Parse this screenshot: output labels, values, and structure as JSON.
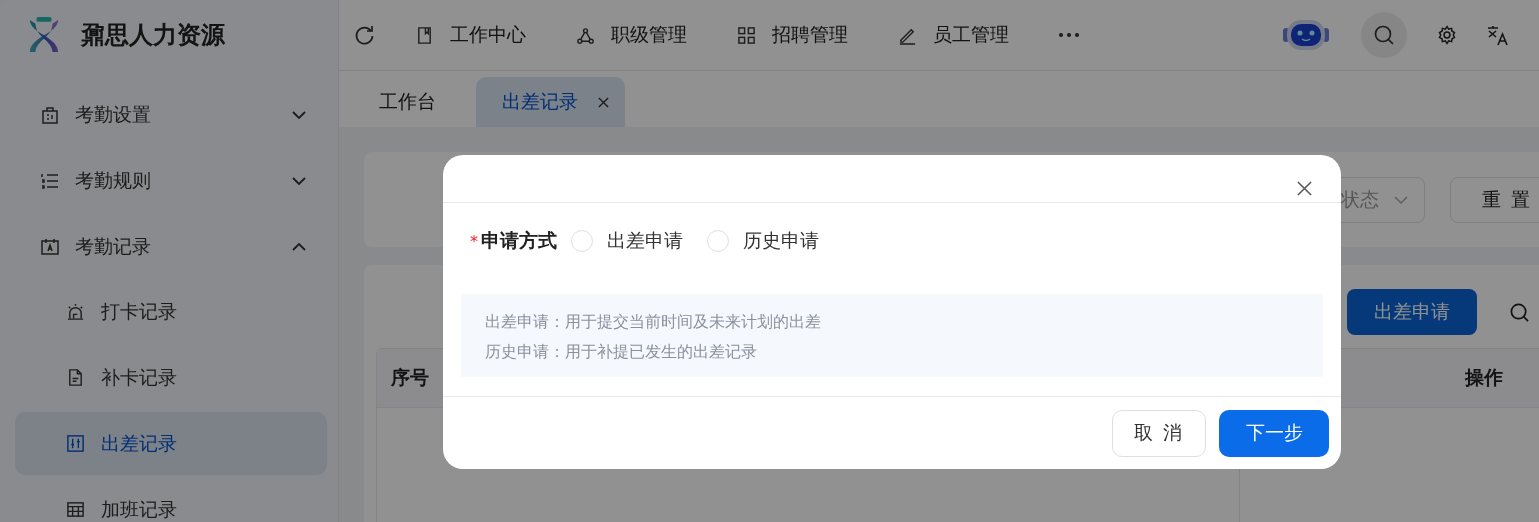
{
  "brand": {
    "name": "鼐思人力资源"
  },
  "sidebar": {
    "items": [
      {
        "label": "考勤设置",
        "expanded": false
      },
      {
        "label": "考勤规则",
        "expanded": false
      },
      {
        "label": "考勤记录",
        "expanded": true,
        "children": [
          {
            "label": "打卡记录",
            "selected": false
          },
          {
            "label": "补卡记录",
            "selected": false
          },
          {
            "label": "出差记录",
            "selected": true
          },
          {
            "label": "加班记录",
            "selected": false
          }
        ]
      }
    ]
  },
  "top_nav": {
    "items": [
      {
        "label": "工作中心"
      },
      {
        "label": "职级管理"
      },
      {
        "label": "招聘管理"
      },
      {
        "label": "员工管理"
      }
    ]
  },
  "tabs": [
    {
      "label": "工作台",
      "selected": false,
      "closable": false
    },
    {
      "label": "出差记录",
      "selected": true,
      "closable": true
    }
  ],
  "filter": {
    "status_select": {
      "placeholder": "状态"
    },
    "reset_button": "重 置"
  },
  "toolbar": {
    "apply_button": "出差申请"
  },
  "table": {
    "columns": [
      {
        "label": "序号"
      },
      {
        "label": "操作"
      }
    ]
  },
  "dialog": {
    "field": {
      "label": "申请方式",
      "required_mark": "*",
      "options": [
        {
          "label": "出差申请",
          "selected": false
        },
        {
          "label": "历史申请",
          "selected": false
        }
      ]
    },
    "notes": [
      "出差申请：用于提交当前时间及未来计划的出差",
      "历史申请：用于补提已发生的出差记录"
    ],
    "buttons": [
      {
        "label": "取 消",
        "kind": "secondary"
      },
      {
        "label": "下一步",
        "kind": "primary"
      }
    ]
  }
}
